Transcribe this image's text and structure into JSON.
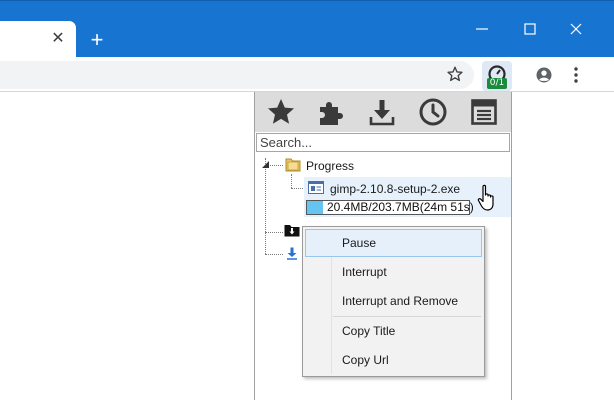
{
  "browser": {
    "tab_close_glyph": "✕",
    "new_tab_glyph": "+",
    "accent_color": "#1874d1"
  },
  "extension": {
    "badge": "0/1",
    "badge_color": "#1a8a3c"
  },
  "popup": {
    "toolbar_icons": [
      "star-icon",
      "puzzle-icon",
      "download-icon",
      "clock-icon",
      "list-icon"
    ],
    "search_placeholder": "Search...",
    "tree": {
      "folder_label": "Progress",
      "file_name": "gimp-2.10.8-setup-2.exe",
      "progress_text": "20.4MB/203.7MB(24m 51s)",
      "progress_fraction": 0.1
    }
  },
  "context_menu": {
    "items": [
      {
        "label": "Pause",
        "highlighted": true
      },
      {
        "label": "Interrupt"
      },
      {
        "label": "Interrupt and Remove"
      },
      {
        "label": "Copy Title"
      },
      {
        "label": "Copy Url"
      }
    ]
  }
}
